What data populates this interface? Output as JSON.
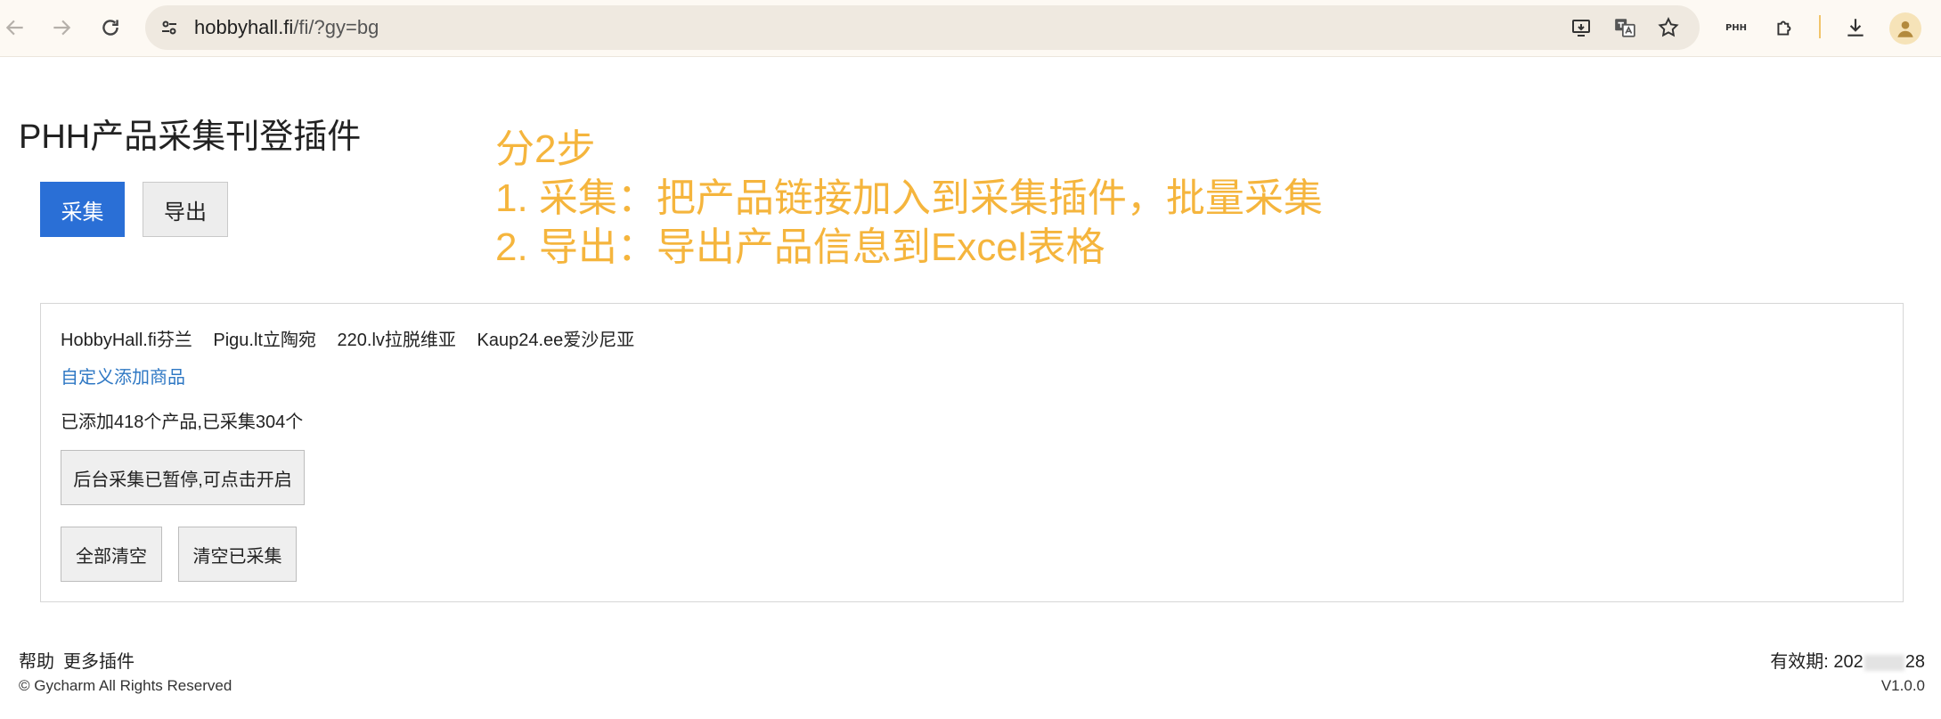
{
  "browser": {
    "url_host": "hobbyhall.fi",
    "url_path": "/fi/?gy=bg",
    "extension_label": "PHH"
  },
  "page": {
    "title": "PHH产品采集刊登插件",
    "collect_button": "采集",
    "export_button": "导出",
    "annotation": {
      "line1": "分2步",
      "line2": "1. 采集：把产品链接加入到采集插件，批量采集",
      "line3": "2. 导出：导出产品信息到Excel表格"
    }
  },
  "panel": {
    "sites": [
      "HobbyHall.fi芬兰",
      "Pigu.lt立陶宛",
      "220.lv拉脱维亚",
      "Kaup24.ee爱沙尼亚"
    ],
    "custom_add_link": "自定义添加商品",
    "stats": "已添加418个产品,已采集304个",
    "background_button": "后台采集已暂停,可点击开启",
    "clear_all_button": "全部清空",
    "clear_collected_button": "清空已采集"
  },
  "footer": {
    "help": "帮助",
    "more_plugins": "更多插件",
    "copyright": "© Gycharm All Rights Reserved",
    "expiry_label": "有效期: 202",
    "expiry_suffix": "28",
    "version": "V1.0.0"
  },
  "colors": {
    "primary": "#2a6fd6",
    "annotation": "#f5b53d",
    "link": "#2f78c4"
  }
}
